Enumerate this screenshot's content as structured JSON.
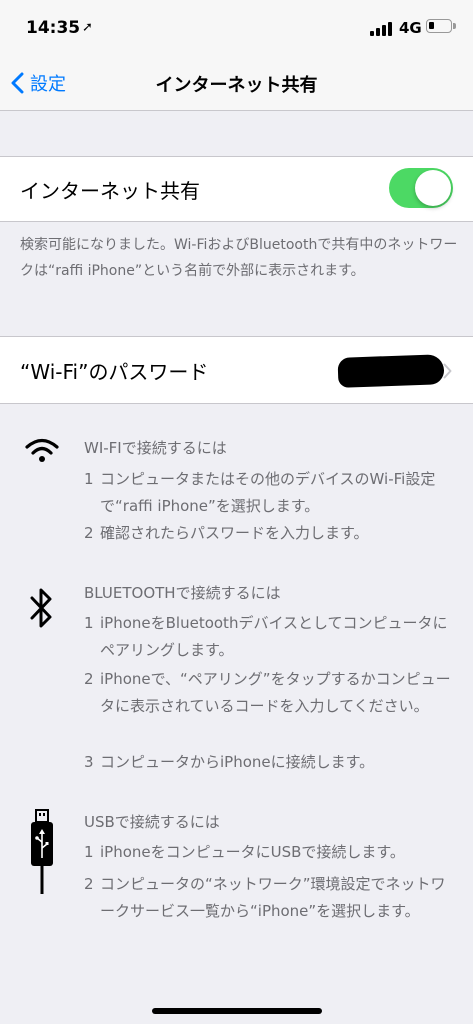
{
  "status_bar": {
    "time": "14:35",
    "network": "4G"
  },
  "nav": {
    "back_label": "設定",
    "title": "インターネット共有"
  },
  "hotspot": {
    "label": "インターネット共有",
    "enabled": true,
    "footer": "検索可能になりました。Wi-FiおよびBluetoothで共有中のネットワークは“raffi iPhone”という名前で外部に表示されます。"
  },
  "wifi_password": {
    "label": "“Wi-Fi”のパスワード"
  },
  "sections": {
    "wifi": {
      "title": "WI-FIで接続するには",
      "steps": [
        {
          "num": "1",
          "text": "コンピュータまたはその他のデバイスのWi-Fi設定で“raffi iPhone”を選択します。"
        },
        {
          "num": "2",
          "text": "確認されたらパスワードを入力します。"
        }
      ]
    },
    "bluetooth": {
      "title": "BLUETOOTHで接続するには",
      "steps": [
        {
          "num": "1",
          "text": "iPhoneをBluetoothデバイスとしてコンピュータにペアリングします。"
        },
        {
          "num": "2",
          "text": "iPhoneで、“ペアリング”をタップするかコンピュータに表示されているコードを入力してください。"
        },
        {
          "num": "3",
          "text": "コンピュータからiPhoneに接続します。"
        }
      ]
    },
    "usb": {
      "title": "USBで接続するには",
      "steps": [
        {
          "num": "1",
          "text": "iPhoneをコンピュータにUSBで接続します。"
        },
        {
          "num": "2",
          "text": "コンピュータの“ネットワーク”環境設定でネットワークサービス一覧から“iPhone”を選択します。"
        }
      ]
    }
  },
  "colors": {
    "accent": "#007aff",
    "toggle_on": "#4cd964",
    "background": "#efeff4",
    "secondary_text": "#6d6d72"
  }
}
